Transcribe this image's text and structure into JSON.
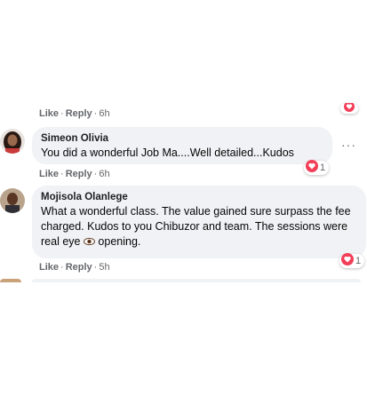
{
  "comments": [
    {
      "meta": {
        "like": "Like",
        "reply": "Reply",
        "time": "6h"
      }
    },
    {
      "author": "Simeon Olivia",
      "text": "You did a wonderful Job Ma....Well detailed...Kudos",
      "reaction_count": "1",
      "reaction_icon": "heart-reaction-icon",
      "more_label": "···",
      "meta": {
        "like": "Like",
        "reply": "Reply",
        "time": "6h"
      }
    },
    {
      "author": "Mojisola Olanlege",
      "text_before_emoji": "What a wonderful class. The value gained sure surpass the fee charged. Kudos to you Chibuzor and team. The sessions were real eye ",
      "emoji": "eye-emoji",
      "text_after_emoji": " opening.",
      "reaction_count": "1",
      "reaction_icon": "heart-reaction-icon",
      "meta": {
        "like": "Like",
        "reply": "Reply",
        "time": "5h"
      }
    }
  ],
  "colors": {
    "bubble": "#f0f2f5",
    "meta_text": "#65676b",
    "love_reaction": "#f33e58"
  }
}
